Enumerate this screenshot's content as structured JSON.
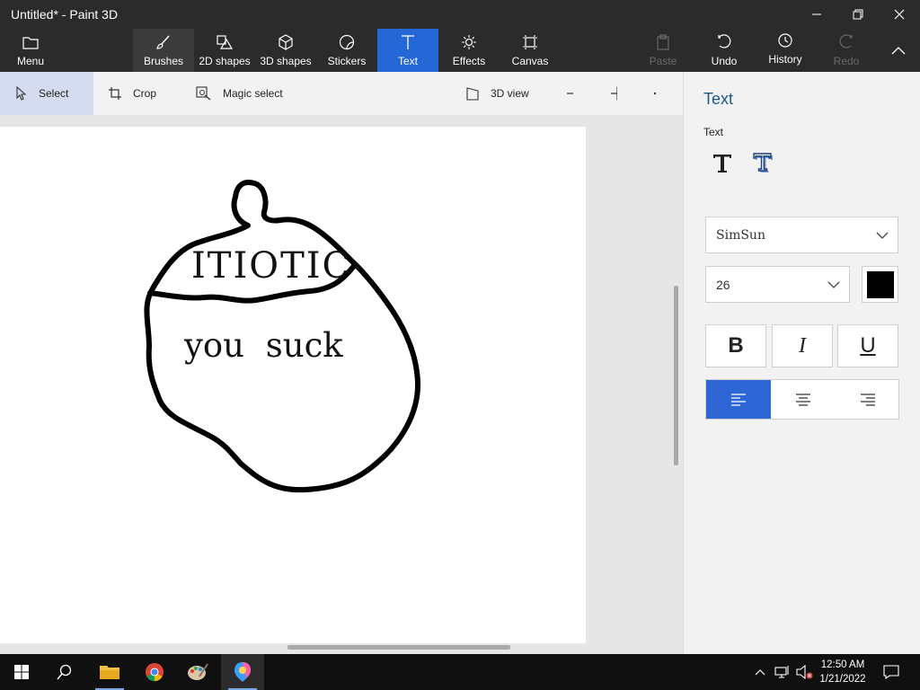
{
  "window": {
    "title": "Untitled* - Paint 3D"
  },
  "toolbar": {
    "menu": "Menu",
    "brushes": "Brushes",
    "shapes2d": "2D shapes",
    "shapes3d": "3D shapes",
    "stickers": "Stickers",
    "text": "Text",
    "effects": "Effects",
    "canvas": "Canvas",
    "paste": "Paste",
    "undo": "Undo",
    "history": "History",
    "redo": "Redo",
    "active_tool": "Text"
  },
  "subbar": {
    "select": "Select",
    "crop": "Crop",
    "magic_select": "Magic select",
    "view3d": "3D view"
  },
  "canvas": {
    "text_top": "ITIOTIC",
    "text_bottom": "you suck"
  },
  "panel": {
    "title": "Text",
    "subtitle": "Text",
    "font": "SimSun",
    "size": "26",
    "color": "#000000",
    "bold": "B",
    "italic": "I",
    "underline": "U",
    "active_alignment": "left"
  },
  "taskbar": {
    "time": "12:50 AM",
    "date": "1/21/2022"
  },
  "colors": {
    "accent": "#2667d8",
    "chrome": "#2b2b2b"
  }
}
